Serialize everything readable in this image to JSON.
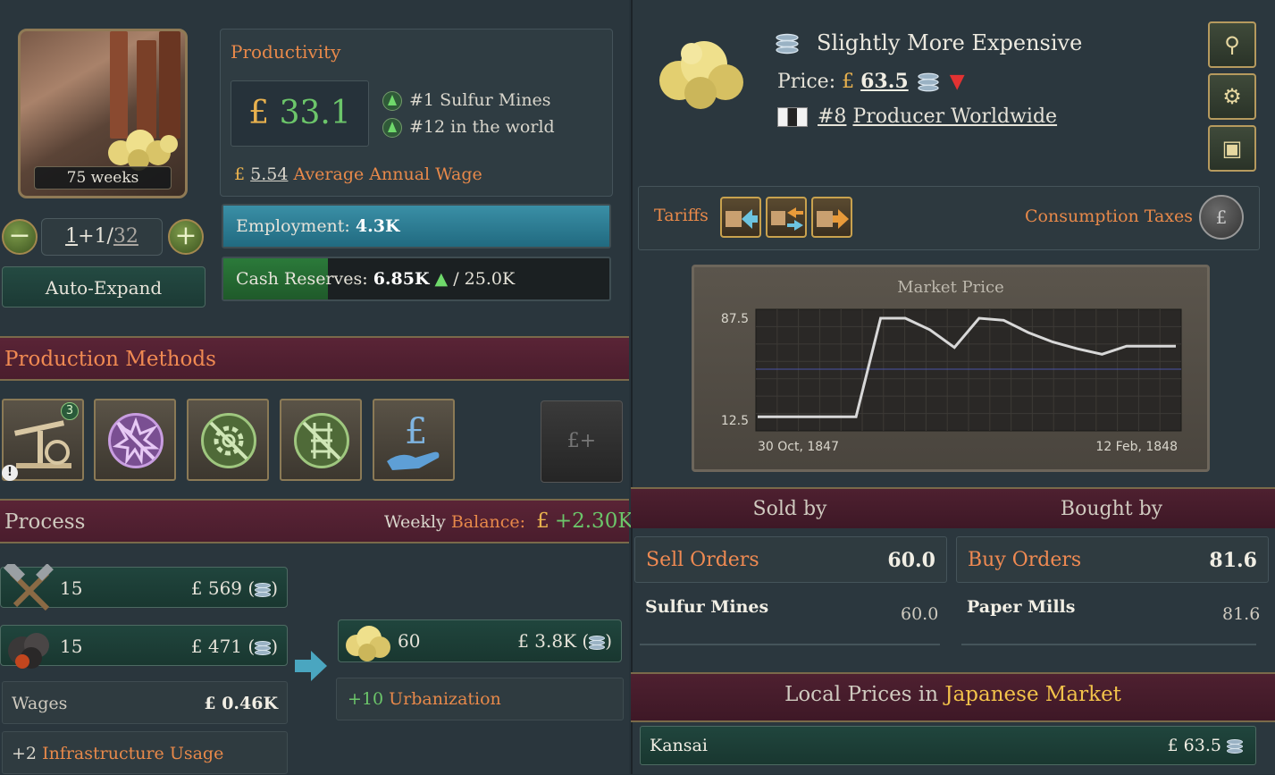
{
  "building": {
    "time_label": "75 weeks",
    "level": {
      "a": "1",
      "plus": "+",
      "b": "1",
      "slash": "/",
      "c": "32"
    },
    "auto_expand_label": "Auto-Expand"
  },
  "productivity": {
    "title": "Productivity",
    "currency": "£",
    "value": "33.1",
    "rank1_prefix": "#1",
    "rank1_text": "Sulfur Mines",
    "rank2_prefix": "#12",
    "rank2_text": "in the world",
    "wage_value": "5.54",
    "wage_label": "Average Annual Wage"
  },
  "employment": {
    "label": "Employment:",
    "value": "4.3K",
    "fill_pct": 100
  },
  "cash": {
    "label": "Cash Reserves:",
    "value": "6.85K",
    "max": "/ 25.0K",
    "fill_pct": 27
  },
  "production_methods": {
    "title": "Production Methods",
    "badge": "3",
    "warn": "!",
    "empty_label": "£+"
  },
  "process": {
    "title": "Process",
    "balance_label_a": "Weekly",
    "balance_label_b": "Balance:",
    "balance_currency": "£",
    "balance_value": "+2.30K",
    "inputs": [
      {
        "qty": "15",
        "cost": "£ 569 (",
        "close": ")"
      },
      {
        "qty": "15",
        "cost": "£ 471 (",
        "close": ")"
      }
    ],
    "wages_label": "Wages",
    "wages_value": "£ 0.46K",
    "infra_value": "+2",
    "infra_label": "Infrastructure Usage",
    "output": {
      "qty": "60",
      "cost": "£ 3.8K (",
      "close": ")"
    },
    "urb_value": "+10",
    "urb_label": "Urbanization"
  },
  "goods": {
    "price_title": "Slightly More Expensive",
    "price_label": "Price:",
    "currency": "£",
    "price_value": "63.5",
    "producer_rank": "#8",
    "producer_label": "Producer Worldwide"
  },
  "tariffs": {
    "label": "Tariffs",
    "consumption_label": "Consumption Taxes"
  },
  "chart_data": {
    "type": "line",
    "title": "Market Price",
    "x": [
      "30 Oct, 1847",
      "",
      "",
      "",
      "",
      "",
      "",
      "",
      "",
      "",
      "",
      "",
      "",
      "",
      "",
      "",
      "",
      "12 Feb, 1848"
    ],
    "x_tick_labels": [
      "30 Oct, 1847",
      "12 Feb, 1848"
    ],
    "y_tick_labels": [
      "87.5",
      "12.5"
    ],
    "ylim": [
      12.5,
      87.5
    ],
    "values": [
      15,
      15,
      15,
      15,
      15,
      87.5,
      87.5,
      79,
      66,
      87.5,
      86,
      77,
      70,
      65,
      61,
      67,
      67,
      67
    ],
    "reference_line": 50,
    "grid": true
  },
  "orders": {
    "sold_by": "Sold by",
    "bought_by": "Bought by",
    "sell_label": "Sell Orders",
    "sell_value": "60.0",
    "buy_label": "Buy Orders",
    "buy_value": "81.6",
    "seller": "Sulfur Mines",
    "seller_value": "60.0",
    "buyer": "Paper Mills",
    "buyer_value": "81.6"
  },
  "local_prices": {
    "title_a": "Local Prices in",
    "title_b": "Japanese Market",
    "rows": [
      {
        "name": "Kansai",
        "value": "£ 63.5"
      }
    ]
  }
}
